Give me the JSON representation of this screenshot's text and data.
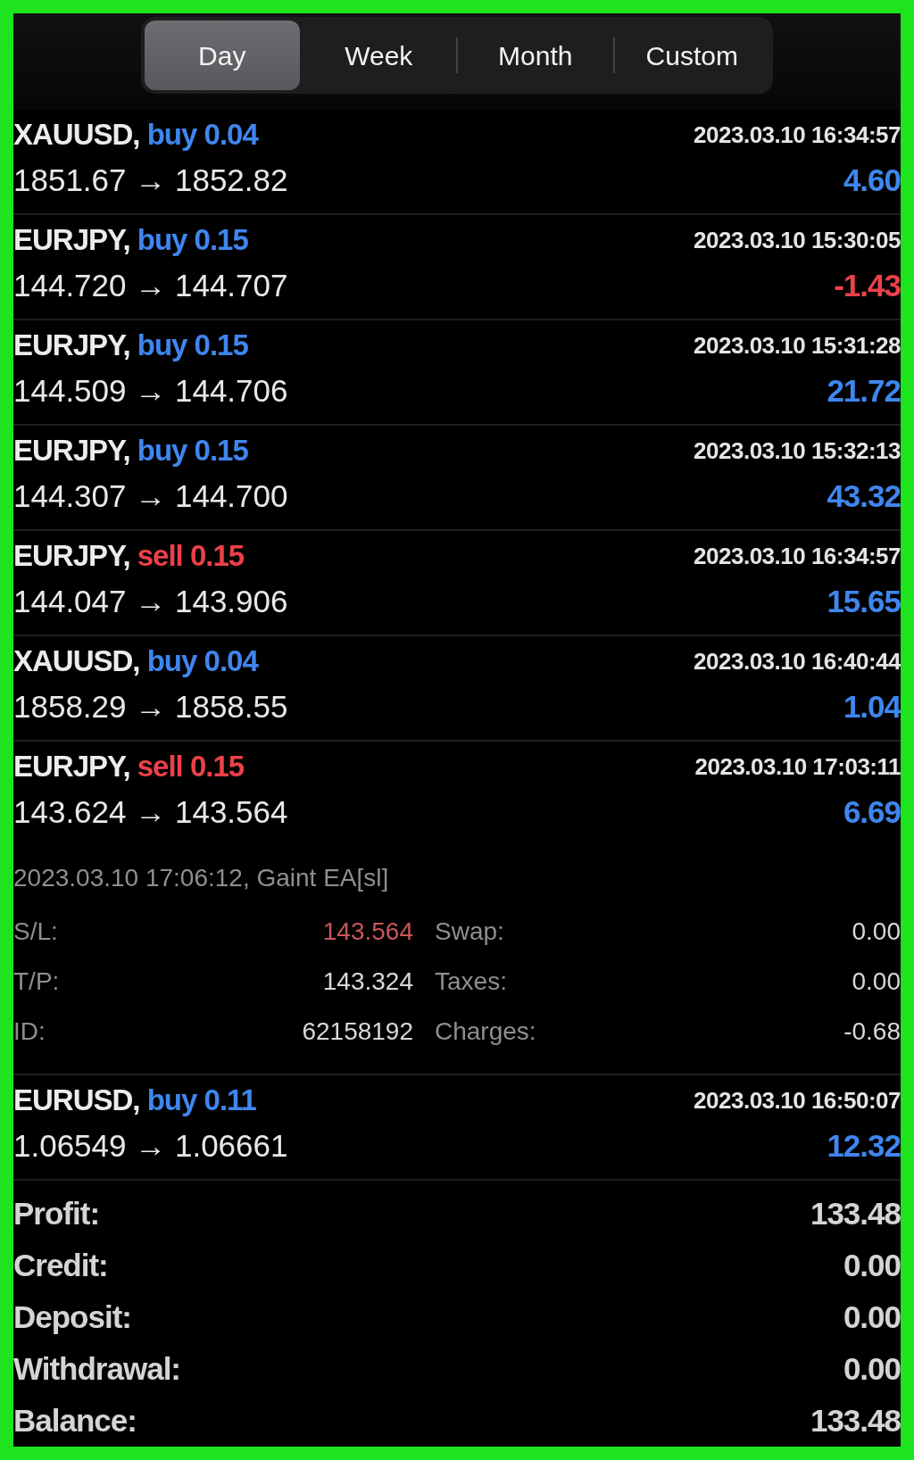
{
  "tabs": [
    {
      "label": "Day",
      "selected": true
    },
    {
      "label": "Week",
      "selected": false
    },
    {
      "label": "Month",
      "selected": false
    },
    {
      "label": "Custom",
      "selected": false
    }
  ],
  "trades": [
    {
      "symbol": "XAUUSD,",
      "order": "buy 0.04",
      "color": "#3f86ee",
      "time": "2023.03.10 16:34:57",
      "prices": "1851.67 → 1852.82",
      "profit": "4.60",
      "loss": false,
      "expanded": false
    },
    {
      "symbol": "EURJPY,",
      "order": "buy 0.15",
      "color": "#3f86ee",
      "time": "2023.03.10 15:30:05",
      "prices": "144.720 → 144.707",
      "profit": "-1.43",
      "loss": true,
      "expanded": false
    },
    {
      "symbol": "EURJPY,",
      "order": "buy 0.15",
      "color": "#3f86ee",
      "time": "2023.03.10 15:31:28",
      "prices": "144.509 → 144.706",
      "profit": "21.72",
      "loss": false,
      "expanded": false
    },
    {
      "symbol": "EURJPY,",
      "order": "buy 0.15",
      "color": "#3f86ee",
      "time": "2023.03.10 15:32:13",
      "prices": "144.307 → 144.700",
      "profit": "43.32",
      "loss": false,
      "expanded": false
    },
    {
      "symbol": "EURJPY,",
      "order": "sell 0.15",
      "color": "#ec4048",
      "time": "2023.03.10 16:34:57",
      "prices": "144.047 → 143.906",
      "profit": "15.65",
      "loss": false,
      "expanded": false
    },
    {
      "symbol": "XAUUSD,",
      "order": "buy 0.04",
      "color": "#3f86ee",
      "time": "2023.03.10 16:40:44",
      "prices": "1858.29 → 1858.55",
      "profit": "1.04",
      "loss": false,
      "expanded": false
    },
    {
      "symbol": "EURJPY,",
      "order": "sell 0.15",
      "color": "#ec4048",
      "time": "2023.03.10 17:03:11",
      "prices": "143.624 → 143.564",
      "profit": "6.69",
      "loss": false,
      "expanded": true,
      "details": {
        "comment": "2023.03.10 17:06:12, Gaint EA[sl]",
        "fields": [
          {
            "label": "S/L:",
            "value": "143.564",
            "hit": true
          },
          {
            "label": "Swap:",
            "value": "0.00",
            "hit": false
          },
          {
            "label": "T/P:",
            "value": "143.324",
            "hit": false
          },
          {
            "label": "Taxes:",
            "value": "0.00",
            "hit": false
          },
          {
            "label": "ID:",
            "value": "62158192",
            "hit": false
          },
          {
            "label": "Charges:",
            "value": "-0.68",
            "hit": false
          }
        ]
      }
    },
    {
      "symbol": "EURUSD,",
      "order": "buy 0.11",
      "color": "#3f86ee",
      "time": "2023.03.10 16:50:07",
      "prices": "1.06549 → 1.06661",
      "profit": "12.32",
      "loss": false,
      "expanded": false
    }
  ],
  "summary": [
    {
      "label": "Profit:",
      "value": "133.48"
    },
    {
      "label": "Credit:",
      "value": "0.00"
    },
    {
      "label": "Deposit:",
      "value": "0.00"
    },
    {
      "label": "Withdrawal:",
      "value": "0.00"
    },
    {
      "label": "Balance:",
      "value": "133.48"
    }
  ]
}
